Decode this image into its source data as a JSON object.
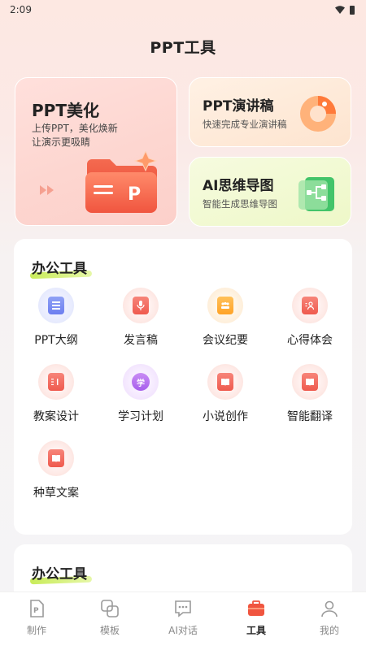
{
  "status": {
    "time": "2:09"
  },
  "page": {
    "title": "PPT工具"
  },
  "feature_cards": {
    "beautify": {
      "title": "PPT美化",
      "desc_line1": "上传PPT，美化焕新",
      "desc_line2": "让演示更吸睛"
    },
    "speech": {
      "title": "PPT演讲稿",
      "desc": "快速完成专业演讲稿"
    },
    "mindmap": {
      "title": "AI思维导图",
      "desc": "智能生成思维导图"
    }
  },
  "section1": {
    "title": "办公工具",
    "tools": [
      {
        "label": "PPT大纲",
        "icon": "outline-list-icon",
        "color": "blue"
      },
      {
        "label": "发言稿",
        "icon": "microphone-icon",
        "color": "red"
      },
      {
        "label": "会议纪要",
        "icon": "meeting-icon",
        "color": "orange"
      },
      {
        "label": "心得体会",
        "icon": "person-card-icon",
        "color": "red"
      },
      {
        "label": "教案设计",
        "icon": "lesson-plan-icon",
        "color": "red"
      },
      {
        "label": "学习计划",
        "icon": "study-icon",
        "color": "purple",
        "glyph": "学"
      },
      {
        "label": "小说创作",
        "icon": "book-icon",
        "color": "red"
      },
      {
        "label": "智能翻译",
        "icon": "translate-book-icon",
        "color": "red"
      },
      {
        "label": "种草文案",
        "icon": "copywriting-book-icon",
        "color": "red"
      }
    ]
  },
  "section2": {
    "title": "办公工具"
  },
  "bottom_nav": [
    {
      "label": "制作",
      "icon": "make-icon",
      "active": false
    },
    {
      "label": "模板",
      "icon": "template-icon",
      "active": false
    },
    {
      "label": "AI对话",
      "icon": "chat-icon",
      "active": false
    },
    {
      "label": "工具",
      "icon": "toolbox-icon",
      "active": true
    },
    {
      "label": "我的",
      "icon": "profile-icon",
      "active": false
    }
  ],
  "colors": {
    "accent": "#f0553f",
    "highlight": "#c9ec5a"
  }
}
